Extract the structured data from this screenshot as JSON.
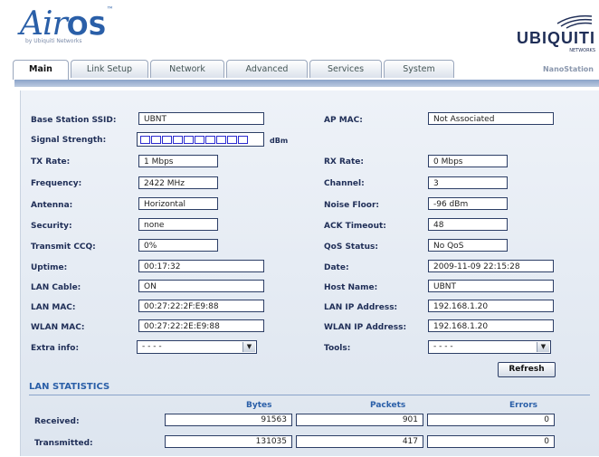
{
  "header": {
    "logo_air": "Air",
    "logo_os": "OS",
    "logo_tm": "™",
    "byline": "by Ubiquiti Networks",
    "brand": "UBIQUITI",
    "brand_sub": "NETWORKS",
    "device": "NanoStation"
  },
  "tabs": [
    {
      "label": "Main",
      "active": true
    },
    {
      "label": "Link Setup",
      "active": false
    },
    {
      "label": "Network",
      "active": false
    },
    {
      "label": "Advanced",
      "active": false
    },
    {
      "label": "Services",
      "active": false
    },
    {
      "label": "System",
      "active": false
    }
  ],
  "left": {
    "ssid": {
      "label": "Base Station SSID:",
      "value": "UBNT"
    },
    "signal": {
      "label": "Signal Strength:",
      "segments": 10,
      "filled": 0,
      "unit": "dBm"
    },
    "tx_rate": {
      "label": "TX Rate:",
      "value": "1 Mbps"
    },
    "frequency": {
      "label": "Frequency:",
      "value": "2422 MHz"
    },
    "antenna": {
      "label": "Antenna:",
      "value": "Horizontal"
    },
    "security": {
      "label": "Security:",
      "value": "none"
    },
    "ccq": {
      "label": "Transmit CCQ:",
      "value": "0%"
    },
    "uptime": {
      "label": "Uptime:",
      "value": "00:17:32"
    },
    "lan_cable": {
      "label": "LAN Cable:",
      "value": "ON"
    },
    "lan_mac": {
      "label": "LAN MAC:",
      "value": "00:27:22:2F:E9:88"
    },
    "wlan_mac": {
      "label": "WLAN MAC:",
      "value": "00:27:22:2E:E9:88"
    },
    "extra": {
      "label": "Extra info:",
      "value": "- - - -"
    }
  },
  "right": {
    "ap_mac": {
      "label": "AP MAC:",
      "value": "Not Associated"
    },
    "rx_rate": {
      "label": "RX Rate:",
      "value": "0 Mbps"
    },
    "channel": {
      "label": "Channel:",
      "value": "3"
    },
    "noise": {
      "label": "Noise Floor:",
      "value": "-96 dBm"
    },
    "ack": {
      "label": "ACK Timeout:",
      "value": "48"
    },
    "qos": {
      "label": "QoS Status:",
      "value": "No QoS"
    },
    "date": {
      "label": "Date:",
      "value": "2009-11-09 22:15:28"
    },
    "host": {
      "label": "Host Name:",
      "value": "UBNT"
    },
    "lan_ip": {
      "label": "LAN IP Address:",
      "value": "192.168.1.20"
    },
    "wlan_ip": {
      "label": "WLAN IP Address:",
      "value": "192.168.1.20"
    },
    "tools": {
      "label": "Tools:",
      "value": "- - - -"
    }
  },
  "refresh_label": "Refresh",
  "stats": {
    "title": "LAN STATISTICS",
    "columns": [
      "Bytes",
      "Packets",
      "Errors"
    ],
    "rows": [
      {
        "label": "Received:",
        "values": [
          "91563",
          "901",
          "0"
        ]
      },
      {
        "label": "Transmitted:",
        "values": [
          "131035",
          "417",
          "0"
        ]
      }
    ]
  },
  "colors": {
    "accent": "#2a5fa8",
    "signal": "#2b2bcf",
    "border": "#2c3e66"
  }
}
